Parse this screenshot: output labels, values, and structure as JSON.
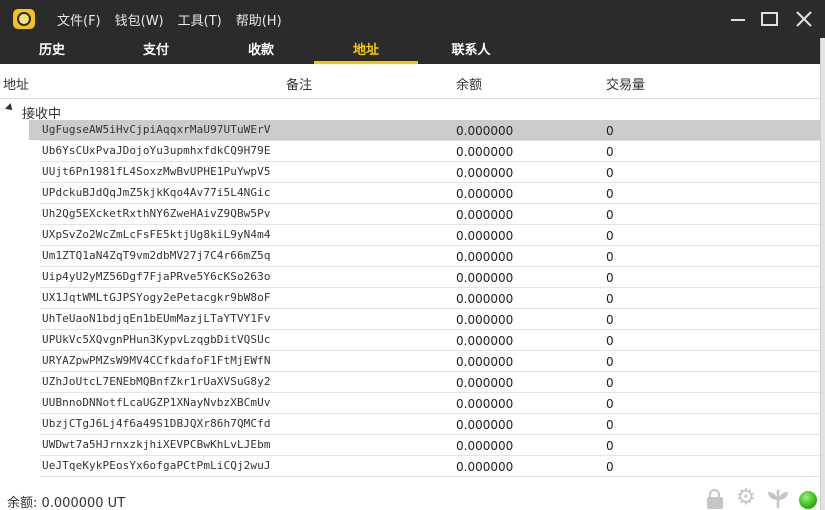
{
  "menu": [
    "文件(F)",
    "钱包(W)",
    "工具(T)",
    "帮助(H)"
  ],
  "tabs": [
    {
      "label": "历史",
      "active": false
    },
    {
      "label": "支付",
      "active": false
    },
    {
      "label": "收款",
      "active": false
    },
    {
      "label": "地址",
      "active": true
    },
    {
      "label": "联系人",
      "active": false
    }
  ],
  "columns": {
    "address": "地址",
    "note": "备注",
    "balance": "余额",
    "txcount": "交易量"
  },
  "group_label": "接收中",
  "rows": [
    {
      "address": "UgFugseAW5iHvCjpiAqqxrMaU97UTuWErV",
      "balance": "0.000000",
      "txcount": "0",
      "selected": true
    },
    {
      "address": "Ub6YsCUxPvaJDojoYu3upmhxfdkCQ9H79E",
      "balance": "0.000000",
      "txcount": "0"
    },
    {
      "address": "UUjt6Pn1981fL4SoxzMwBvUPHE1PuYwpV5",
      "balance": "0.000000",
      "txcount": "0"
    },
    {
      "address": "UPdckuBJdQqJmZ5kjkKqo4Av77i5L4NGic",
      "balance": "0.000000",
      "txcount": "0"
    },
    {
      "address": "Uh2Qg5EXcketRxthNY6ZweHAivZ9QBw5Pv",
      "balance": "0.000000",
      "txcount": "0"
    },
    {
      "address": "UXpSvZo2WcZmLcFsFE5ktjUg8kiL9yN4m4",
      "balance": "0.000000",
      "txcount": "0"
    },
    {
      "address": "Um1ZTQ1aN4ZqT9vm2dbMV27j7C4r66mZ5q",
      "balance": "0.000000",
      "txcount": "0"
    },
    {
      "address": "Uip4yU2yMZ56Dgf7FjaPRve5Y6cKSo263o",
      "balance": "0.000000",
      "txcount": "0"
    },
    {
      "address": "UX1JqtWMLtGJPSYogy2ePetacgkr9bW8oF",
      "balance": "0.000000",
      "txcount": "0"
    },
    {
      "address": "UhTeUaoN1bdjqEn1bEUmMazjLTaYTVY1Fv",
      "balance": "0.000000",
      "txcount": "0"
    },
    {
      "address": "UPUkVc5XQvgnPHun3KypvLzqgbDitVQSUc",
      "balance": "0.000000",
      "txcount": "0"
    },
    {
      "address": "URYAZpwPMZsW9MV4CCfkdafoF1FtMjEWfN",
      "balance": "0.000000",
      "txcount": "0"
    },
    {
      "address": "UZhJoUtcL7ENEbMQBnfZkr1rUaXVSuG8y2",
      "balance": "0.000000",
      "txcount": "0"
    },
    {
      "address": "UUBnnoDNNotfLcaUGZP1XNayNvbzXBCmUv",
      "balance": "0.000000",
      "txcount": "0"
    },
    {
      "address": "UbzjCTgJ6Lj4f6a49S1DBJQXr86h7QMCfd",
      "balance": "0.000000",
      "txcount": "0"
    },
    {
      "address": "UWDwt7a5HJrnxzkjhiXEVPCBwKhLvLJEbm",
      "balance": "0.000000",
      "txcount": "0"
    },
    {
      "address": "UeJTqeKykPEosYx6ofgaPCtPmLiCQj2wuJ",
      "balance": "0.000000",
      "txcount": "0"
    }
  ],
  "status": {
    "balance_text": "余额: 0.000000 UT"
  },
  "colors": {
    "accent": "#f7c800",
    "bar": "#2b2b2b",
    "selected_row": "#cccccc",
    "online": "#2fb812"
  },
  "icons": [
    "app-logo-icon",
    "minimize-icon",
    "maximize-icon",
    "close-icon",
    "lock-icon",
    "gear-icon",
    "sprout-icon",
    "status-dot-icon"
  ]
}
